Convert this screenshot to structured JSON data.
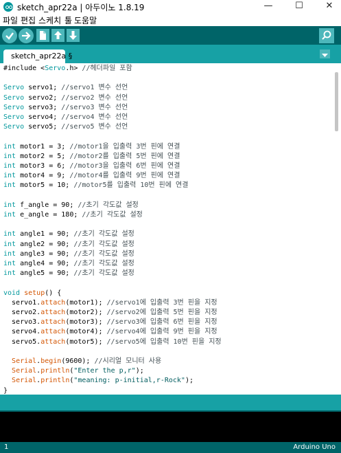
{
  "window": {
    "title": "sketch_apr22a | 아두이노 1.8.19",
    "minimize": "—",
    "maximize": "☐",
    "close": "✕"
  },
  "menu": [
    {
      "label": "파일"
    },
    {
      "label": "편집"
    },
    {
      "label": "스케치"
    },
    {
      "label": "툴"
    },
    {
      "label": "도움말"
    }
  ],
  "toolbar": {
    "buttons": [
      "verify-icon",
      "upload-icon",
      "new-icon",
      "open-icon",
      "save-icon"
    ],
    "serial_monitor": "magnifier-icon",
    "accent": "#006468"
  },
  "tabs": [
    {
      "label": "sketch_apr22a §"
    }
  ],
  "editor": {
    "lines": [
      [
        {
          "t": "#include <"
        },
        {
          "t": "Servo",
          "c": "ty"
        },
        {
          "t": ".h> "
        },
        {
          "t": "//헤더파일 포함",
          "c": "cm"
        }
      ],
      [],
      [
        {
          "t": "Servo",
          "c": "ty"
        },
        {
          "t": " servo1; "
        },
        {
          "t": "//servo1 변수 선언",
          "c": "cm"
        }
      ],
      [
        {
          "t": "Servo",
          "c": "ty"
        },
        {
          "t": " servo2; "
        },
        {
          "t": "//servo2 변수 선언",
          "c": "cm"
        }
      ],
      [
        {
          "t": "Servo",
          "c": "ty"
        },
        {
          "t": " servo3; "
        },
        {
          "t": "//servo3 변수 선언",
          "c": "cm"
        }
      ],
      [
        {
          "t": "Servo",
          "c": "ty"
        },
        {
          "t": " servo4; "
        },
        {
          "t": "//servo4 변수 선언",
          "c": "cm"
        }
      ],
      [
        {
          "t": "Servo",
          "c": "ty"
        },
        {
          "t": " servo5; "
        },
        {
          "t": "//servo5 변수 선언",
          "c": "cm"
        }
      ],
      [],
      [
        {
          "t": "int",
          "c": "ty"
        },
        {
          "t": " motor1 = 3; "
        },
        {
          "t": "//motor1을 입출력 3번 핀에 연결",
          "c": "cm"
        }
      ],
      [
        {
          "t": "int",
          "c": "ty"
        },
        {
          "t": " motor2 = 5; "
        },
        {
          "t": "//motor2를 입출력 5번 핀에 연결",
          "c": "cm"
        }
      ],
      [
        {
          "t": "int",
          "c": "ty"
        },
        {
          "t": " motor3 = 6; "
        },
        {
          "t": "//motor3을 입출력 6번 핀에 연결",
          "c": "cm"
        }
      ],
      [
        {
          "t": "int",
          "c": "ty"
        },
        {
          "t": " motor4 = 9; "
        },
        {
          "t": "//motor4를 입출력 9번 핀에 연결",
          "c": "cm"
        }
      ],
      [
        {
          "t": "int",
          "c": "ty"
        },
        {
          "t": " motor5 = 10; "
        },
        {
          "t": "//motor5를 입출력 10번 핀에 연결",
          "c": "cm"
        }
      ],
      [],
      [
        {
          "t": "int",
          "c": "ty"
        },
        {
          "t": " f_angle = 90; "
        },
        {
          "t": "//초기 각도값 설정",
          "c": "cm"
        }
      ],
      [
        {
          "t": "int",
          "c": "ty"
        },
        {
          "t": " e_angle = 180; "
        },
        {
          "t": "//초기 각도값 설정",
          "c": "cm"
        }
      ],
      [],
      [
        {
          "t": "int",
          "c": "ty"
        },
        {
          "t": " angle1 = 90; "
        },
        {
          "t": "//초기 각도값 설정",
          "c": "cm"
        }
      ],
      [
        {
          "t": "int",
          "c": "ty"
        },
        {
          "t": " angle2 = 90; "
        },
        {
          "t": "//초기 각도값 설정",
          "c": "cm"
        }
      ],
      [
        {
          "t": "int",
          "c": "ty"
        },
        {
          "t": " angle3 = 90; "
        },
        {
          "t": "//초기 각도값 설정",
          "c": "cm"
        }
      ],
      [
        {
          "t": "int",
          "c": "ty"
        },
        {
          "t": " angle4 = 90; "
        },
        {
          "t": "//초기 각도값 설정",
          "c": "cm"
        }
      ],
      [
        {
          "t": "int",
          "c": "ty"
        },
        {
          "t": " angle5 = 90; "
        },
        {
          "t": "//초기 각도값 설정",
          "c": "cm"
        }
      ],
      [],
      [
        {
          "t": "void",
          "c": "ty"
        },
        {
          "t": " "
        },
        {
          "t": "setup",
          "c": "kw"
        },
        {
          "t": "() {"
        }
      ],
      [
        {
          "t": "  servo1."
        },
        {
          "t": "attach",
          "c": "kw"
        },
        {
          "t": "(motor1); "
        },
        {
          "t": "//servo1에 입출력 3번 핀을 지정",
          "c": "cm"
        }
      ],
      [
        {
          "t": "  servo2."
        },
        {
          "t": "attach",
          "c": "kw"
        },
        {
          "t": "(motor2); "
        },
        {
          "t": "//servo2에 입출력 5번 핀을 지정",
          "c": "cm"
        }
      ],
      [
        {
          "t": "  servo3."
        },
        {
          "t": "attach",
          "c": "kw"
        },
        {
          "t": "(motor3); "
        },
        {
          "t": "//servo3에 입출력 6번 핀을 지정",
          "c": "cm"
        }
      ],
      [
        {
          "t": "  servo4."
        },
        {
          "t": "attach",
          "c": "kw"
        },
        {
          "t": "(motor4); "
        },
        {
          "t": "//servo4에 입출력 9번 핀을 지정",
          "c": "cm"
        }
      ],
      [
        {
          "t": "  servo5."
        },
        {
          "t": "attach",
          "c": "kw"
        },
        {
          "t": "(motor5); "
        },
        {
          "t": "//servo5에 입출력 10번 핀을 지정",
          "c": "cm"
        }
      ],
      [],
      [
        {
          "t": "  "
        },
        {
          "t": "Serial",
          "c": "kw"
        },
        {
          "t": "."
        },
        {
          "t": "begin",
          "c": "kw"
        },
        {
          "t": "(9600); "
        },
        {
          "t": "//시리얼 모니터 사용",
          "c": "cm"
        }
      ],
      [
        {
          "t": "  "
        },
        {
          "t": "Serial",
          "c": "kw"
        },
        {
          "t": "."
        },
        {
          "t": "println",
          "c": "kw"
        },
        {
          "t": "("
        },
        {
          "t": "\"Enter the p,r\"",
          "c": "st"
        },
        {
          "t": ");"
        }
      ],
      [
        {
          "t": "  "
        },
        {
          "t": "Serial",
          "c": "kw"
        },
        {
          "t": "."
        },
        {
          "t": "println",
          "c": "kw"
        },
        {
          "t": "("
        },
        {
          "t": "\"meaning: p-initial,r-Rock\"",
          "c": "st"
        },
        {
          "t": ");"
        }
      ],
      [
        {
          "t": "}"
        }
      ]
    ]
  },
  "status": {
    "line_number": "1",
    "board": "Arduino Uno"
  }
}
